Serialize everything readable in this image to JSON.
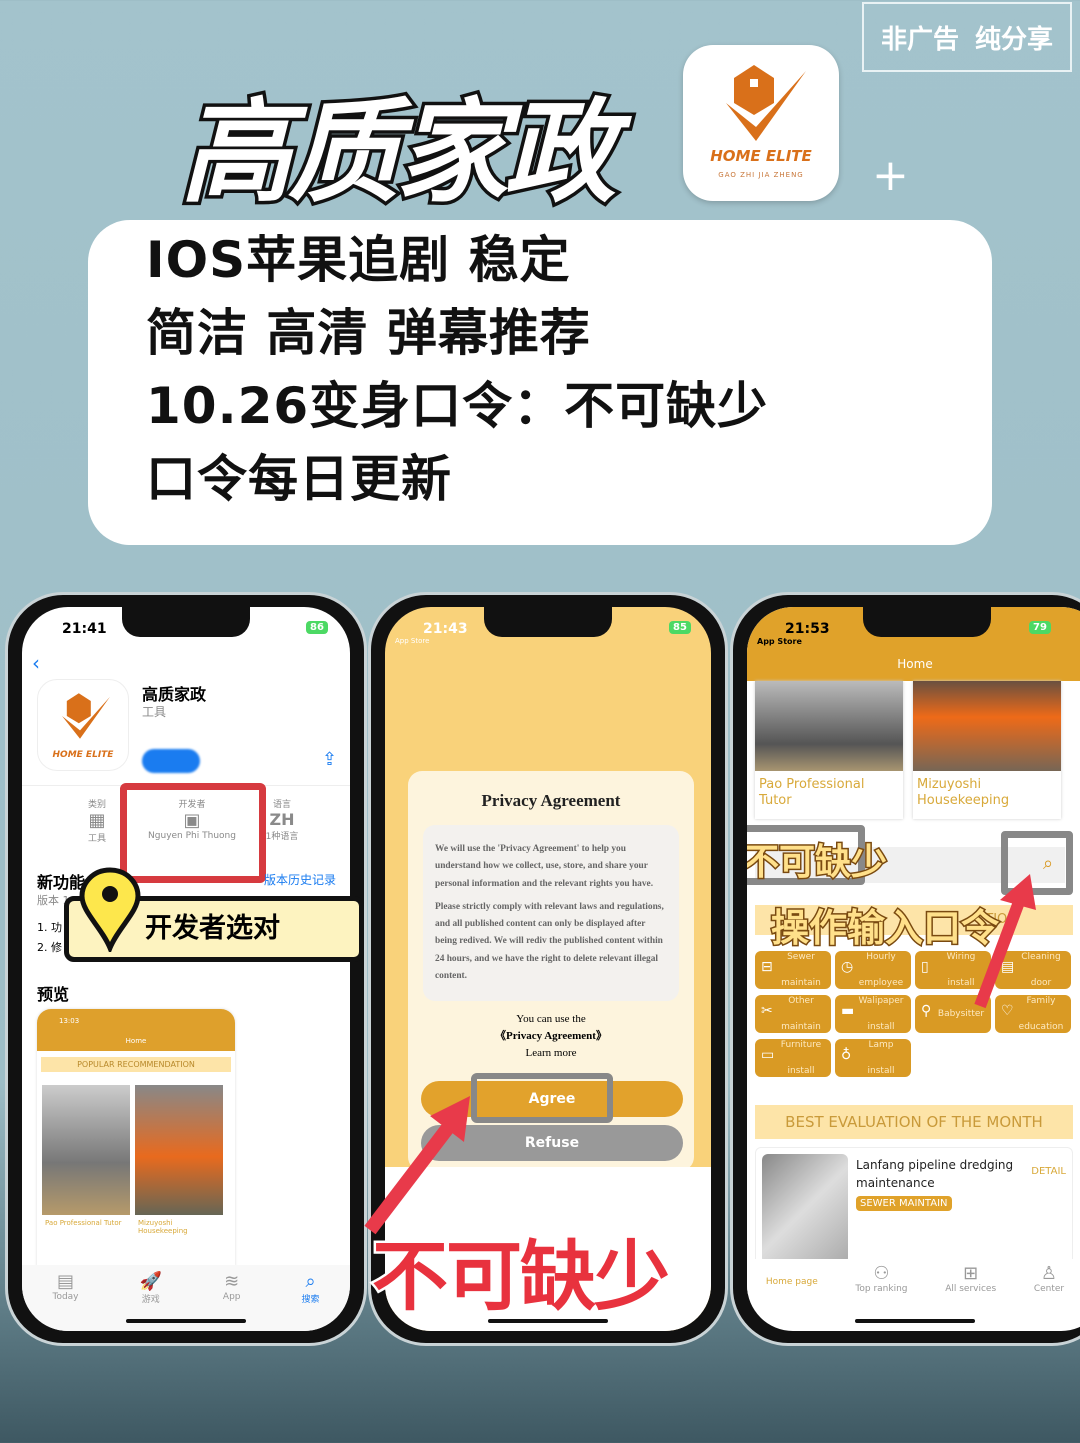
{
  "poster": {
    "title": "高质家政",
    "badge": [
      "非广告",
      "纯分享"
    ],
    "logo": {
      "brand": "HOME ELITE",
      "sub": "GAO ZHI JIA ZHENG"
    },
    "lines": [
      "IOS苹果追剧  稳定",
      "简洁  高清  弹幕推荐",
      "10.26变身口令：不可缺少",
      "口令每日更新"
    ],
    "callout": "开发者选对",
    "must_have": "不可缺少",
    "enter_code": "操作输入口令"
  },
  "colors": {
    "accent": "#e0a22a",
    "bg": "#a3c3cc",
    "red": "#e83a4a",
    "battery": "#4cd964"
  },
  "phone1": {
    "time": "21:41",
    "battery": "86",
    "app_name": "高质家政",
    "app_category": "工具",
    "info": [
      {
        "label": "类别",
        "value": "工具",
        "icon": "calculator-icon"
      },
      {
        "label": "开发者",
        "value": "Nguyen Phi Thuong",
        "icon": "developer-icon"
      },
      {
        "label": "语言",
        "value": "ZH",
        "sub": "1种语言"
      }
    ],
    "whats_new": "新功能",
    "version_history": "版本历史记录",
    "version": "版本 1",
    "notes": [
      "1. 功",
      "2. 修"
    ],
    "preview": "预览",
    "preview_screen": {
      "time": "13:03",
      "header": "Home",
      "section": "POPULAR RECOMMENDATION",
      "items": [
        "Pao Professional Tutor",
        "Mizuyoshi Housekeeping"
      ]
    },
    "tabs": [
      {
        "label": "Today",
        "icon": "today-icon"
      },
      {
        "label": "游戏",
        "icon": "rocket-icon"
      },
      {
        "label": "App",
        "icon": "layers-icon"
      },
      {
        "label": "搜索",
        "icon": "search-icon",
        "active": true
      }
    ]
  },
  "phone2": {
    "time": "21:43",
    "battery": "85",
    "back": "App Store",
    "dialog_title": "Privacy Agreement",
    "paragraphs": [
      "We will use the 'Privacy Agreement' to help you understand how we collect, use, store, and share your personal information and the relevant rights you have.",
      "Please strictly comply with relevant laws and regulations, and all published content can only be displayed after being redived. We will rediv the published content within 24 hours, and we have the right to delete relevant illegal content."
    ],
    "use_text": "You can use the",
    "link": "《Privacy Agreement》",
    "learn_more": "Learn more",
    "agree": "Agree",
    "refuse": "Refuse"
  },
  "phone3": {
    "time": "21:53",
    "battery": "79",
    "back": "App Store",
    "header": "Home",
    "items": [
      "Pao Professional Tutor",
      "Mizuyoshi Housekeeping"
    ],
    "section_hidden": "TION",
    "services": [
      [
        "Sewer",
        "maintain"
      ],
      [
        "Hourly",
        "employee"
      ],
      [
        "Wiring",
        "install"
      ],
      [
        "Cleaning",
        "door"
      ],
      [
        "Other",
        "maintain"
      ],
      [
        "Walipaper",
        "install"
      ],
      [
        "Babysitter",
        ""
      ],
      [
        "Family",
        "education"
      ],
      [
        "Furniture",
        "install"
      ],
      [
        "Lamp",
        "install"
      ]
    ],
    "best": "BEST EVALUATION OF THE MONTH",
    "eval": {
      "title": "Lanfang pipeline dredging maintenance",
      "tag": "SEWER MAINTAIN",
      "detail": "DETAIL"
    },
    "tabs": [
      {
        "label": "Home page",
        "icon": "home-icon",
        "active": true
      },
      {
        "label": "Top ranking",
        "icon": "ranking-icon"
      },
      {
        "label": "All services",
        "icon": "grid-icon"
      },
      {
        "label": "Center",
        "icon": "user-icon"
      }
    ]
  }
}
